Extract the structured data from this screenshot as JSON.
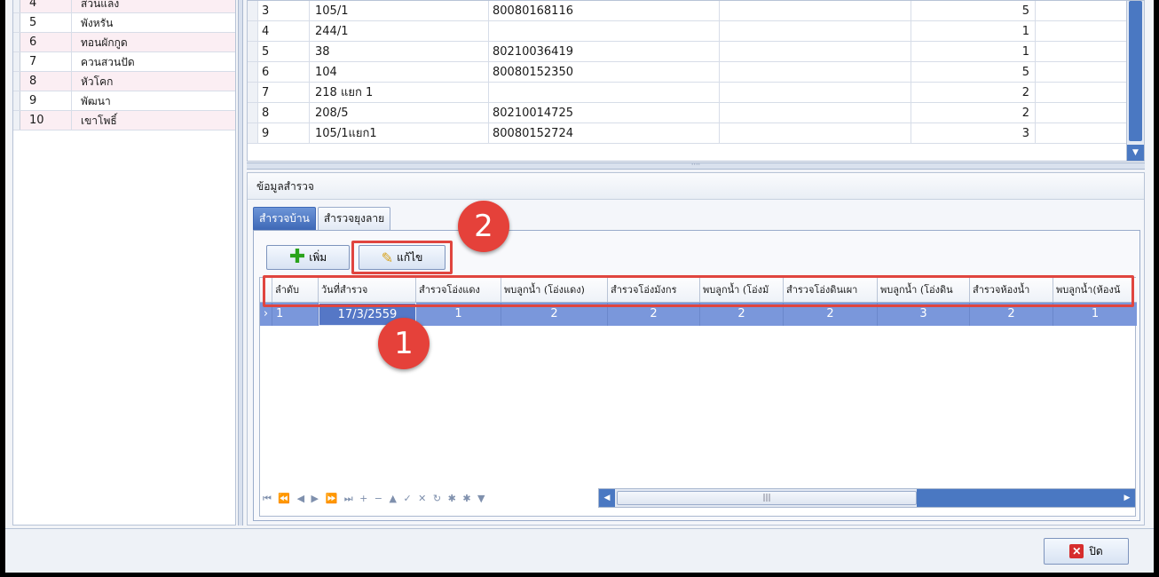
{
  "left_list": [
    {
      "num": "4",
      "name": "สวนแลง"
    },
    {
      "num": "5",
      "name": "พังหรัน"
    },
    {
      "num": "6",
      "name": "ทอนผักกูด"
    },
    {
      "num": "7",
      "name": "ควนสวนปัด"
    },
    {
      "num": "8",
      "name": "หัวโคก"
    },
    {
      "num": "9",
      "name": "พัฒนา"
    },
    {
      "num": "10",
      "name": "เขาโพธิ์"
    }
  ],
  "top_grid": [
    {
      "seq": "3",
      "house_no": "105/1",
      "code": "80080168116",
      "count": "5"
    },
    {
      "seq": "4",
      "house_no": "244/1",
      "code": "",
      "count": "1"
    },
    {
      "seq": "5",
      "house_no": "38",
      "code": "80210036419",
      "count": "1"
    },
    {
      "seq": "6",
      "house_no": "104",
      "code": "80080152350",
      "count": "5"
    },
    {
      "seq": "7",
      "house_no": "218 แยก 1",
      "code": "",
      "count": "2"
    },
    {
      "seq": "8",
      "house_no": "208/5",
      "code": "80210014725",
      "count": "2"
    },
    {
      "seq": "9",
      "house_no": "105/1แยก1",
      "code": "80080152724",
      "count": "3"
    }
  ],
  "survey": {
    "group_title": "ข้อมูลสำรวจ",
    "tabs": [
      "สำรวจบ้าน",
      "สำรวจยุงลาย"
    ],
    "add_label": "เพิ่ม",
    "edit_label": "แก้ไข",
    "columns": [
      "ลำดับ",
      "วันที่สำรวจ",
      "สำรวจโอ่งแดง",
      "พบลูกน้ำ (โอ่งแดง)",
      "สำรวจโอ่งมังกร",
      "พบลูกน้ำ (โอ่งมั",
      "สำรวจโอ่งดินเผา",
      "พบลูกน้ำ (โอ่งดิน",
      "สำรวจห้องน้ำ",
      "พบลูกน้ำ(ห้องน้"
    ],
    "row": [
      "1",
      "17/3/2559",
      "1",
      "2",
      "2",
      "2",
      "2",
      "3",
      "2",
      "1"
    ]
  },
  "navigator": "⏮ ⏪ ◀ ▶ ⏩ ⏭ + − ▲ ✓ ✕ ↻ ✱ ✱ ▼",
  "badges": {
    "one": "1",
    "two": "2"
  },
  "footer": {
    "close_label": "ปิด"
  },
  "colors": {
    "highlight": "#e0453f",
    "selection": "#7a97db",
    "accent": "#4a78c2"
  }
}
